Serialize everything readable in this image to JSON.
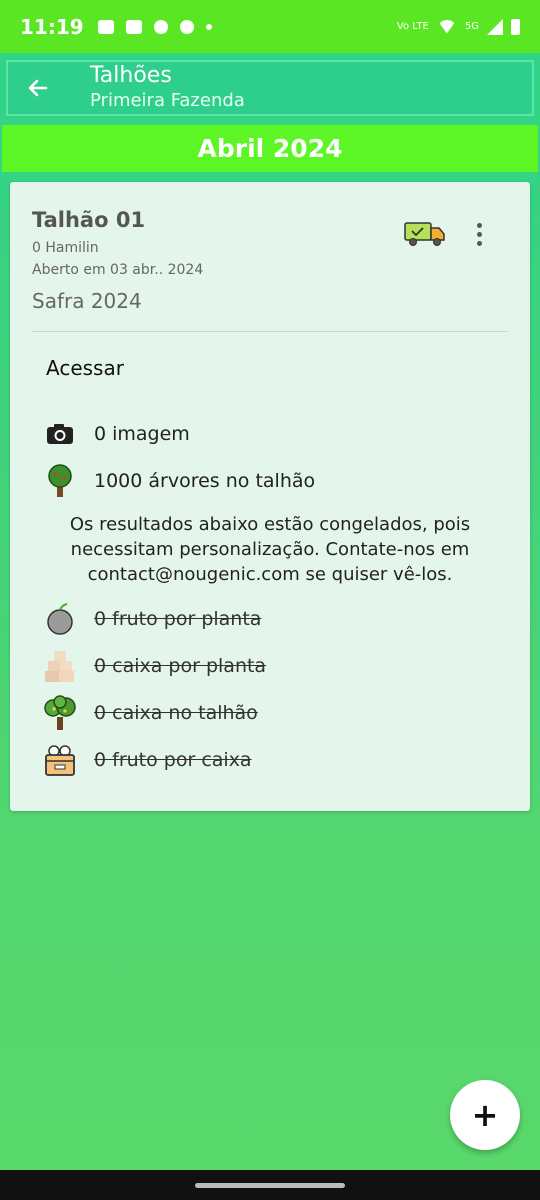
{
  "status_bar": {
    "time": "11:19",
    "network_label": "Vo LTE",
    "signal_label": "5G"
  },
  "app_bar": {
    "title": "Talhões",
    "subtitle": "Primeira Fazenda"
  },
  "month_header": "Abril 2024",
  "card": {
    "title": "Talhão 01",
    "owner": "0 Hamilin",
    "opened": "Aberto em 03 abr.. 2024",
    "safra": "Safra 2024",
    "access_label": "Acessar",
    "images": "0 imagem",
    "trees": "1000 árvores no talhão",
    "frozen_note": "Os resultados abaixo estão congelados, pois necessitam personalização. Contate-nos em contact@nougenic.com se quiser vê-los.",
    "fruit_per_plant": "0 fruto por planta",
    "box_per_plant": "0 caixa por planta",
    "box_per_plot": "0 caixa no talhão",
    "fruit_per_box": "0 fruto por caixa"
  },
  "fab_label": "+",
  "colors": {
    "status_bar": "#5ae622",
    "app_bar": "#2ecf8c",
    "month_bar": "#5cf526",
    "card": "#e4f6ec"
  }
}
